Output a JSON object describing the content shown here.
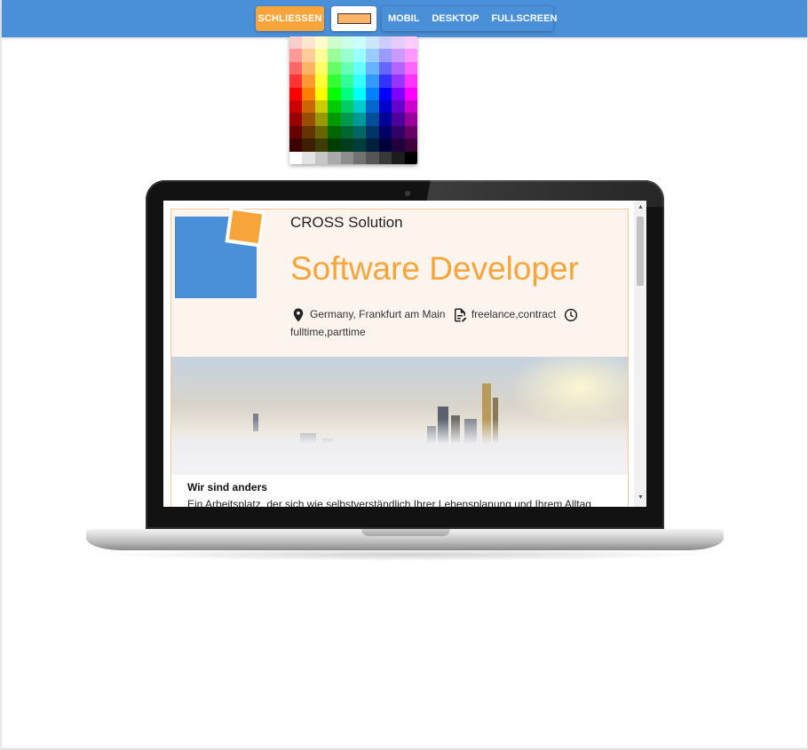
{
  "toolbar": {
    "close_label": "SCHLIESSEN",
    "selected_color": "#ffb366",
    "views": [
      "MOBIL",
      "DESKTOP",
      "FULLSCREEN"
    ]
  },
  "colors": {
    "toolbar_bg": "#4a90d9",
    "accent": "#f7a53a"
  },
  "preview": {
    "company": "CROSS Solution",
    "job_title": "Software Developer",
    "location": "Germany, Frankfurt am Main",
    "contract_types": "freelance,contract",
    "schedule": "fulltime,parttime",
    "icons": [
      "location-pin-icon",
      "document-icon",
      "clock-icon"
    ],
    "section_title": "Wir sind anders",
    "section_text": "Ein Arbeitsplatz, der sich wie selbstverständlich Ihrer Lebensplanung und Ihrem Alltag"
  }
}
